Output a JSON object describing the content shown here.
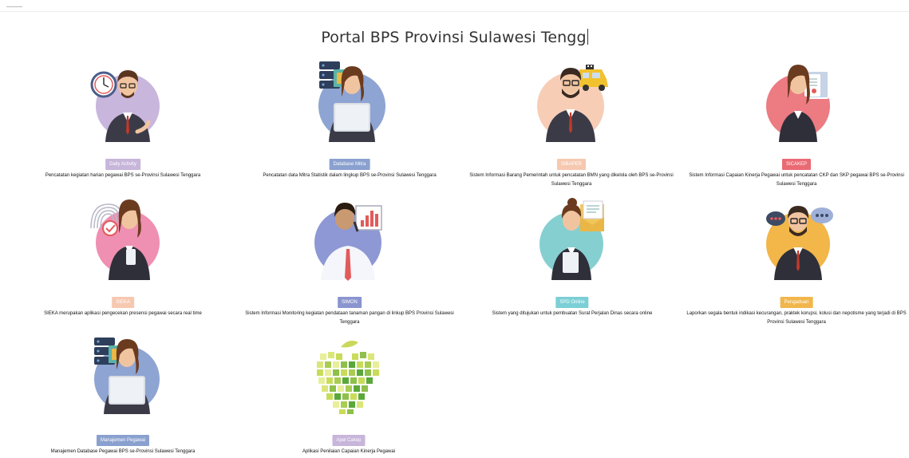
{
  "page": {
    "title": "Portal BPS Provinsi Sulawesi Tengg"
  },
  "apps": [
    {
      "label": "Daily Activity",
      "color": "#c7b5da",
      "bg": "#c9b6dd",
      "desc": "Pencatatan kegiatan harian pegawai BPS se-Provinsi Sulawesi Tenggara"
    },
    {
      "label": "Database Mitra",
      "color": "#8aa1cf",
      "bg": "#8ea4d2",
      "desc": "Pencatatan data Mitra Statistik dalam lingkup BPS se-Provinsi Sulawesi Tenggara"
    },
    {
      "label": "SIBAPER",
      "color": "#f6c8b0",
      "bg": "#f7cdb6",
      "desc": "Sistem Informasi Barang Pemerintah untuk pencatatan BMN yang dikelola oleh BPS se-Provinsi Sulawesi Tenggara"
    },
    {
      "label": "SICAKEP",
      "color": "#ea6a73",
      "bg": "#ec7b82",
      "desc": "Sistem Informasi Capaian Kinerja Pegawai untuk pencatatan CKP dan SKP pegawai BPS se-Provinsi Sulawesi Tenggara"
    },
    {
      "label": "SIEKA",
      "color": "#f6c8b0",
      "bg": "#ef8fb2",
      "desc": "SIEKA merupakan aplikasi pengecekan presensi pegawai secara real time"
    },
    {
      "label": "SIMON",
      "color": "#8a95cf",
      "bg": "#8d98d4",
      "desc": "Sistem Informasi Monitoring kegiatan pendataan tanaman pangan di linkup BPS Provinsi Sulawesi Tenggara"
    },
    {
      "label": "SPD Online",
      "color": "#7ccfd6",
      "bg": "#86cfd1",
      "desc": "Sistem yang ditujukan untuk pembuatan Surat Perjalan Dinas secara online"
    },
    {
      "label": "Pengaduan",
      "color": "#f1b64c",
      "bg": "#f2b649",
      "desc": "Laporkan segala bentuk indikasi kecurangan, praktek korupsi, kolusi dan nepotisme yang terjadi di BPS Provinsi Sulawesi Tenggara"
    },
    {
      "label": "Manajemen Pegawai",
      "color": "#8aa1cf",
      "bg": "#8ea4d2",
      "desc": "Manajemen Database Pegawai BPS se-Provinsi Sulawesi Tenggara"
    },
    {
      "label": "Apel Cakep",
      "color": "#c7b5da",
      "bg": "#ffffff",
      "desc": "Aplikasi Penilaian Capaian Kinerja Pegawai"
    }
  ]
}
